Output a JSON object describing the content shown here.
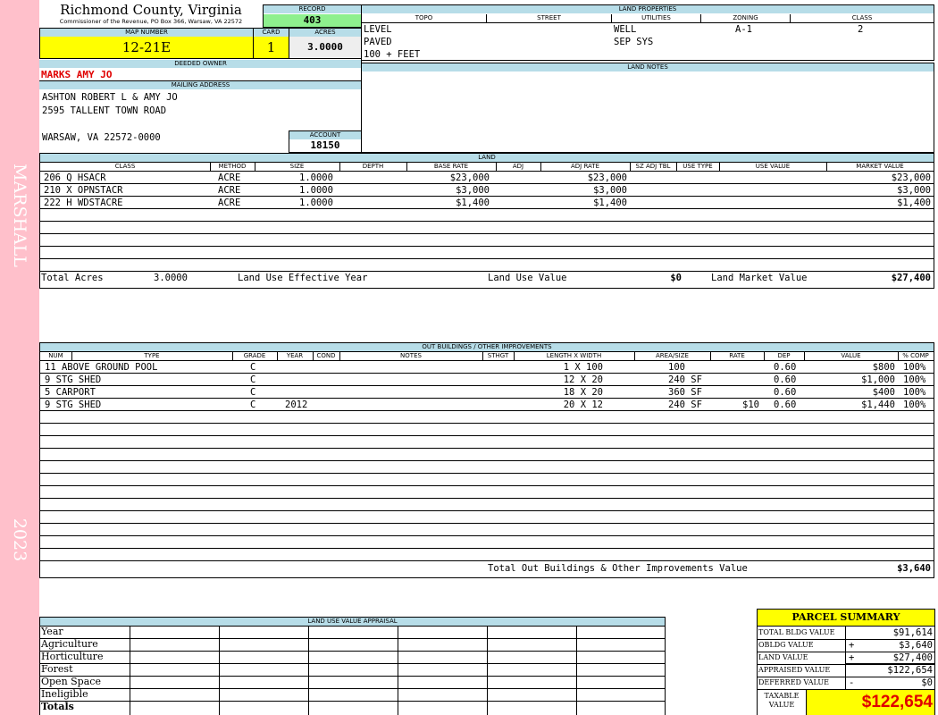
{
  "sidebar": {
    "district": "MARSHALL",
    "year": "2023"
  },
  "header": {
    "county": "Richmond County, Virginia",
    "subline": "Commissioner of the Revenue, PO Box 366, Warsaw, VA 22572",
    "record_label": "RECORD",
    "record": "403",
    "map_label": "MAP NUMBER",
    "map_number": "12-21E",
    "card_label": "CARD",
    "card": "1",
    "acres_label": "ACRES",
    "acres": "3.0000"
  },
  "owner": {
    "deeded_label": "DEEDED OWNER",
    "deeded": "MARKS AMY JO",
    "mailing_label": "MAILING ADDRESS",
    "addr1": "ASHTON ROBERT L & AMY JO",
    "addr2": "2595 TALLENT TOWN ROAD",
    "addr3": "WARSAW, VA 22572-0000",
    "account_label": "ACCOUNT",
    "account": "18150"
  },
  "land_properties": {
    "title": "LAND PROPERTIES",
    "columns": [
      "TOPO",
      "STREET",
      "UTILITIES",
      "ZONING",
      "CLASS"
    ],
    "topo": [
      "LEVEL",
      "PAVED",
      "100 + FEET"
    ],
    "utilities": [
      "WELL",
      "SEP SYS"
    ],
    "zoning": "A-1",
    "class": "2"
  },
  "land_notes": {
    "title": "LAND NOTES"
  },
  "land": {
    "title": "LAND",
    "columns": [
      "CLASS",
      "METHOD",
      "SIZE",
      "DEPTH",
      "BASE RATE",
      "ADJ",
      "ADJ RATE",
      "SZ ADJ TBL",
      "USE TYPE",
      "USE VALUE",
      "MARKET VALUE"
    ],
    "rows": [
      {
        "class": "206 Q HSACR",
        "method": "ACRE",
        "size": "1.0000",
        "base": "$23,000",
        "adj_rate": "$23,000",
        "market": "$23,000"
      },
      {
        "class": "210 X OPNSTACR",
        "method": "ACRE",
        "size": "1.0000",
        "base": "$3,000",
        "adj_rate": "$3,000",
        "market": "$3,000"
      },
      {
        "class": "222 H WDSTACRE",
        "method": "ACRE",
        "size": "1.0000",
        "base": "$1,400",
        "adj_rate": "$1,400",
        "market": "$1,400"
      }
    ],
    "total_acres_label": "Total Acres",
    "total_acres": "3.0000",
    "effective_year_label": "Land Use Effective Year",
    "use_value_label": "Land Use Value",
    "use_value": "$0",
    "market_label": "Land Market Value",
    "market": "$27,400"
  },
  "outbuildings": {
    "title": "OUT BUILDINGS / OTHER IMPROVEMENTS",
    "columns": [
      "NUM",
      "TYPE",
      "GRADE",
      "YEAR",
      "COND",
      "NOTES",
      "STHGT",
      "LENGTH X WIDTH",
      "AREA/SIZE",
      "RATE",
      "DEP",
      "VALUE",
      "% COMP"
    ],
    "rows": [
      {
        "type": "11 ABOVE GROUND POOL",
        "grade": "C",
        "year": "",
        "lw": "1 X 100",
        "area": "100",
        "rate": "",
        "dep": "0.60",
        "value": "$800",
        "comp": "100%"
      },
      {
        "type": "9 STG SHED",
        "grade": "C",
        "year": "",
        "lw": "12 X 20",
        "area": "240 SF",
        "rate": "",
        "dep": "0.60",
        "value": "$1,000",
        "comp": "100%"
      },
      {
        "type": "5 CARPORT",
        "grade": "C",
        "year": "",
        "lw": "18 X 20",
        "area": "360 SF",
        "rate": "",
        "dep": "0.60",
        "value": "$400",
        "comp": "100%"
      },
      {
        "type": "9 STG SHED",
        "grade": "C",
        "year": "2012",
        "lw": "20 X 12",
        "area": "240 SF",
        "rate": "$10",
        "dep": "0.60",
        "value": "$1,440",
        "comp": "100%"
      }
    ],
    "total_label": "Total Out Buildings & Other Improvements Value",
    "total": "$3,640"
  },
  "land_use_appraisal": {
    "title": "LAND USE VALUE APPRAISAL",
    "rows": [
      "Year",
      "Agriculture",
      "Horticulture",
      "Forest",
      "Open Space",
      "Ineligible",
      "Totals"
    ]
  },
  "parcel_summary": {
    "title": "PARCEL SUMMARY",
    "rows": [
      {
        "label": "TOTAL BLDG VALUE",
        "op": "",
        "value": "$91,614"
      },
      {
        "label": "OBLDG VALUE",
        "op": "+",
        "value": "$3,640"
      },
      {
        "label": "LAND VALUE",
        "op": "+",
        "value": "$27,400"
      },
      {
        "label": "APPRAISED VALUE",
        "op": "",
        "value": "$122,654"
      },
      {
        "label": "DEFERRED VALUE",
        "op": "-",
        "value": "$0"
      }
    ],
    "taxable_label_1": "TAXABLE",
    "taxable_label_2": "VALUE",
    "taxable": "$122,654",
    "colors": {
      "yellow": "#ffff00",
      "red": "#ff0000",
      "pink": "#ffc0cb",
      "header_blue": "#b7dde8",
      "green": "#8ef08e"
    }
  }
}
